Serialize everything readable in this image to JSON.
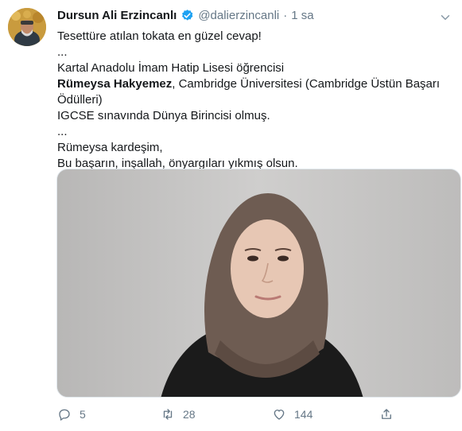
{
  "tweet": {
    "author_name": "Dursun Ali Erzincanlı",
    "handle": "@dalierzincanli",
    "separator": "·",
    "time": "1 sa",
    "lines": {
      "l1": "Tesettüre atılan tokata en güzel cevap!",
      "l2": "...",
      "l3": "Kartal Anadolu İmam Hatip Lisesi öğrencisi",
      "l4_bold": "Rümeysa Hakyemez",
      "l4_rest": ", Cambridge Üniversitesi (Cambridge Üstün Başarı Ödülleri)",
      "l5": "IGCSE sınavında Dünya Birincisi olmuş.",
      "l6": "...",
      "l7": "Rümeysa kardeşim,",
      "l8": "Bu başarın, inşallah, önyargıları yıkmış olsun."
    },
    "actions": {
      "reply_count": "5",
      "retweet_count": "28",
      "like_count": "144"
    }
  },
  "colors": {
    "text": "#14171a",
    "secondary": "#657786",
    "verified_blue": "#1da1f2",
    "avatar_bg": "#caa24a",
    "photo_bg": "#c9c8c7",
    "hijab": "#6e5c52",
    "jacket": "#1b1b1b"
  },
  "icons": {
    "verified": "verified-badge-icon",
    "caret": "chevron-down-icon",
    "reply": "reply-icon",
    "retweet": "retweet-icon",
    "like": "heart-icon",
    "share": "share-icon"
  }
}
